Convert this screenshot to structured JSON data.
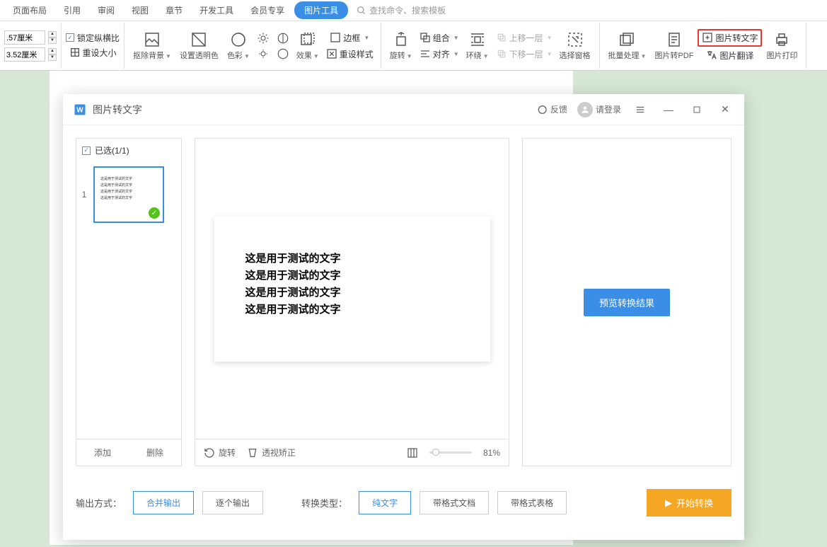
{
  "menu": {
    "items": [
      "页面布局",
      "引用",
      "审阅",
      "视图",
      "章节",
      "开发工具",
      "会员专享"
    ],
    "active": "图片工具",
    "search_placeholder": "查找命令、搜索模板"
  },
  "ribbon": {
    "size1": ".57厘米",
    "size2": "3.52厘米",
    "lock_aspect": "锁定纵横比",
    "reset_size": "重设大小",
    "remove_bg": "抠除背景",
    "set_transparent": "设置透明色",
    "color": "色彩",
    "effect": "效果",
    "border": "边框",
    "reset_style": "重设样式",
    "rotate": "旋转",
    "combine": "组合",
    "align": "对齐",
    "wrap": "环绕",
    "move_up": "上移一层",
    "move_down": "下移一层",
    "select_pane": "选择窗格",
    "batch": "批量处理",
    "to_pdf": "图片转PDF",
    "to_text": "图片转文字",
    "translate": "图片翻译",
    "print": "图片打印"
  },
  "dialog": {
    "title": "图片转文字",
    "feedback": "反馈",
    "login": "请登录",
    "selected": "已选(1/1)",
    "thumb_index": "1",
    "preview_lines": [
      "这是用于测试的文字",
      "这是用于测试的文字",
      "这是用于测试的文字",
      "这是用于测试的文字"
    ],
    "add": "添加",
    "delete": "删除",
    "rotate": "旋转",
    "perspective": "透视矫正",
    "zoom": "81%",
    "preview_result": "预览转换结果",
    "output_mode_label": "输出方式：",
    "output_merge": "合并输出",
    "output_separate": "逐个输出",
    "convert_type_label": "转换类型：",
    "type_text": "纯文字",
    "type_doc": "带格式文档",
    "type_table": "带格式表格",
    "start": "开始转换"
  }
}
